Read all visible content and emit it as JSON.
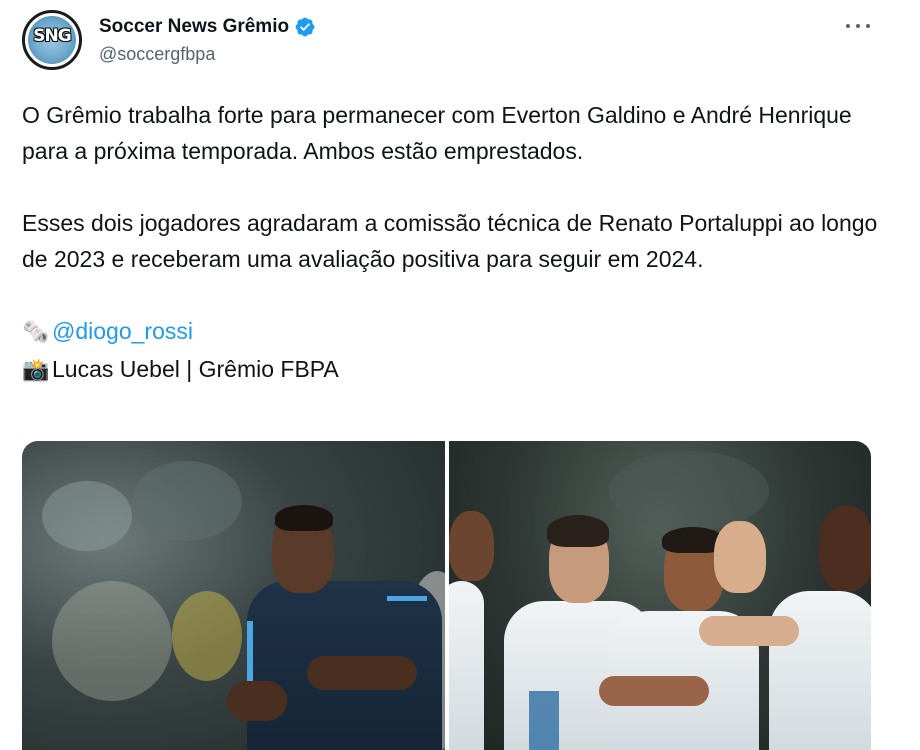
{
  "author": {
    "display_name": "Soccer News Grêmio",
    "handle": "@soccergfbpa",
    "avatar_text": "SNG",
    "verified": true
  },
  "tweet": {
    "paragraph_1": "O Grêmio trabalha forte para permanecer com Everton Galdino e André Henrique para a próxima temporada. Ambos estão emprestados.",
    "paragraph_2": "Esses dois jogadores agradaram a comissão técnica de Renato Portaluppi ao longo de 2023 e receberam uma avaliação positiva para seguir em 2024.",
    "credit_mention_emoji": "🗞️",
    "credit_mention": "@diogo_rossi",
    "credit_photo_emoji": "📸",
    "credit_photo": "Lucas Uebel | Grêmio FBPA"
  },
  "media": {
    "count": 2
  },
  "icons": {
    "verified": "verified-badge-icon",
    "more": "more-options-icon"
  },
  "colors": {
    "link": "#1d9bf0",
    "verified": "#1d9bf0",
    "secondary_text": "#536471",
    "text": "#0f1419"
  }
}
